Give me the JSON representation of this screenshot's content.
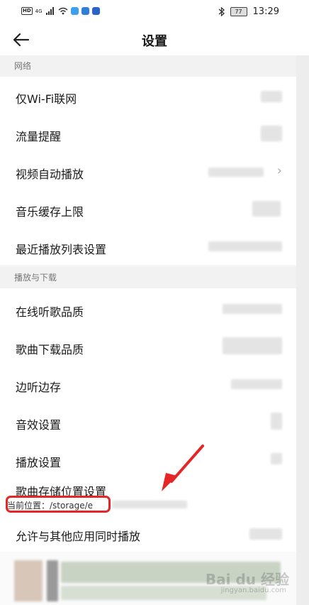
{
  "status_bar": {
    "network_tag": "HD",
    "signal": "4G",
    "time": "13:29",
    "battery": "77"
  },
  "header": {
    "title": "设置"
  },
  "sections": [
    {
      "label": "网络",
      "items": [
        "仅Wi-Fi联网",
        "流量提醒",
        "视频自动播放",
        "音乐缓存上限",
        "最近播放列表设置"
      ]
    },
    {
      "label": "播放与下载",
      "items": [
        "在线听歌品质",
        "歌曲下载品质",
        "边听边存",
        "音效设置",
        "播放设置",
        "歌曲存储位置设置",
        "允许与其他应用同时播放"
      ]
    }
  ],
  "storage_location": {
    "current": "当前位置：/storage/e"
  },
  "colors": {
    "highlight": "#e62626",
    "arrow": "#e62626"
  },
  "watermark": {
    "brand": "Bai du 经验",
    "url": "jingyan.baidu.com"
  }
}
